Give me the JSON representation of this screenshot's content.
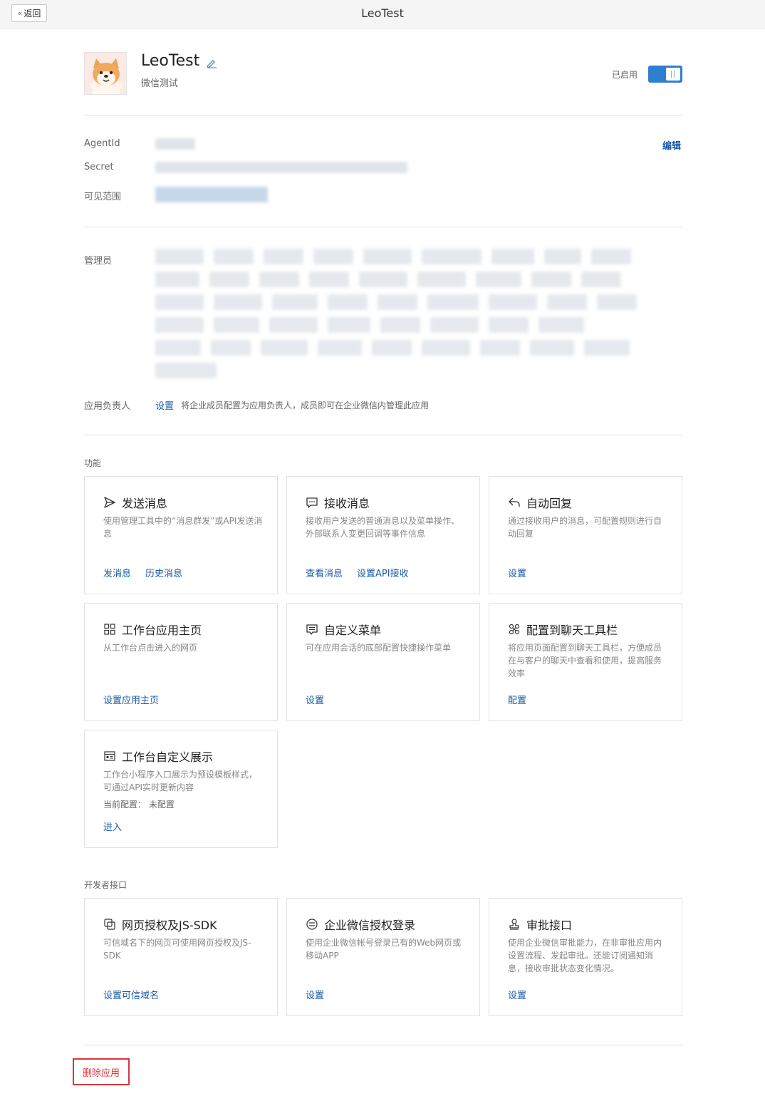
{
  "header": {
    "back_label": "返回",
    "window_title": "LeoTest"
  },
  "app": {
    "name": "LeoTest",
    "description": "微信测试",
    "status_label": "已启用",
    "enabled": true
  },
  "info": {
    "agentid_label": "AgentId",
    "secret_label": "Secret",
    "visible_range_label": "可见范围",
    "edit_label": "编辑"
  },
  "admins": {
    "label": "管理员"
  },
  "owner": {
    "label": "应用负责人",
    "set_label": "设置",
    "hint": "将企业成员配置为应用负责人，成员即可在企业微信内管理此应用"
  },
  "features": {
    "section_title": "功能",
    "cards": [
      {
        "icon": "send-icon",
        "title": "发送消息",
        "desc": "使用管理工具中的“消息群发”或API发送消息",
        "actions": [
          "发消息",
          "历史消息"
        ]
      },
      {
        "icon": "chat-bubble-icon",
        "title": "接收消息",
        "desc": "接收用户发送的普通消息以及菜单操作、外部联系人变更回调等事件信息",
        "actions": [
          "查看消息",
          "设置API接收"
        ]
      },
      {
        "icon": "reply-icon",
        "title": "自动回复",
        "desc": "通过接收用户的消息，可配置规则进行自动回复",
        "actions": [
          "设置"
        ]
      },
      {
        "icon": "grid-icon",
        "title": "工作台应用主页",
        "desc": "从工作台点击进入的网页",
        "actions": [
          "设置应用主页"
        ]
      },
      {
        "icon": "menu-icon",
        "title": "自定义菜单",
        "desc": "可在应用会话的底部配置快捷操作菜单",
        "actions": [
          "设置"
        ]
      },
      {
        "icon": "toolbar-icon",
        "title": "配置到聊天工具栏",
        "desc": "将应用页面配置到聊天工具栏，方便成员在与客户的聊天中查看和使用，提高服务效率",
        "actions": [
          "配置"
        ]
      },
      {
        "icon": "dashboard-icon",
        "title": "工作台自定义展示",
        "desc": "工作台小程序入口展示为预设模板样式，可通过API实时更新内容",
        "extra": "当前配置： 未配置",
        "actions": [
          "进入"
        ]
      }
    ]
  },
  "developer": {
    "section_title": "开发者接口",
    "cards": [
      {
        "icon": "web-auth-icon",
        "title": "网页授权及JS-SDK",
        "desc": "可信域名下的网页可使用网页授权及JS-SDK",
        "actions": [
          "设置可信域名"
        ]
      },
      {
        "icon": "login-icon",
        "title": "企业微信授权登录",
        "desc": "使用企业微信帐号登录已有的Web网页或移动APP",
        "actions": [
          "设置"
        ]
      },
      {
        "icon": "stamp-icon",
        "title": "审批接口",
        "desc": "使用企业微信审批能力，在非审批应用内设置流程、发起审批。还能订阅通知消息，接收审批状态变化情况。",
        "actions": [
          "设置"
        ]
      }
    ]
  },
  "footer": {
    "delete_label": "删除应用",
    "delete_color": "#d9363e"
  },
  "colors": {
    "accent": "#2f7fd1",
    "link": "#1a5aa5"
  }
}
